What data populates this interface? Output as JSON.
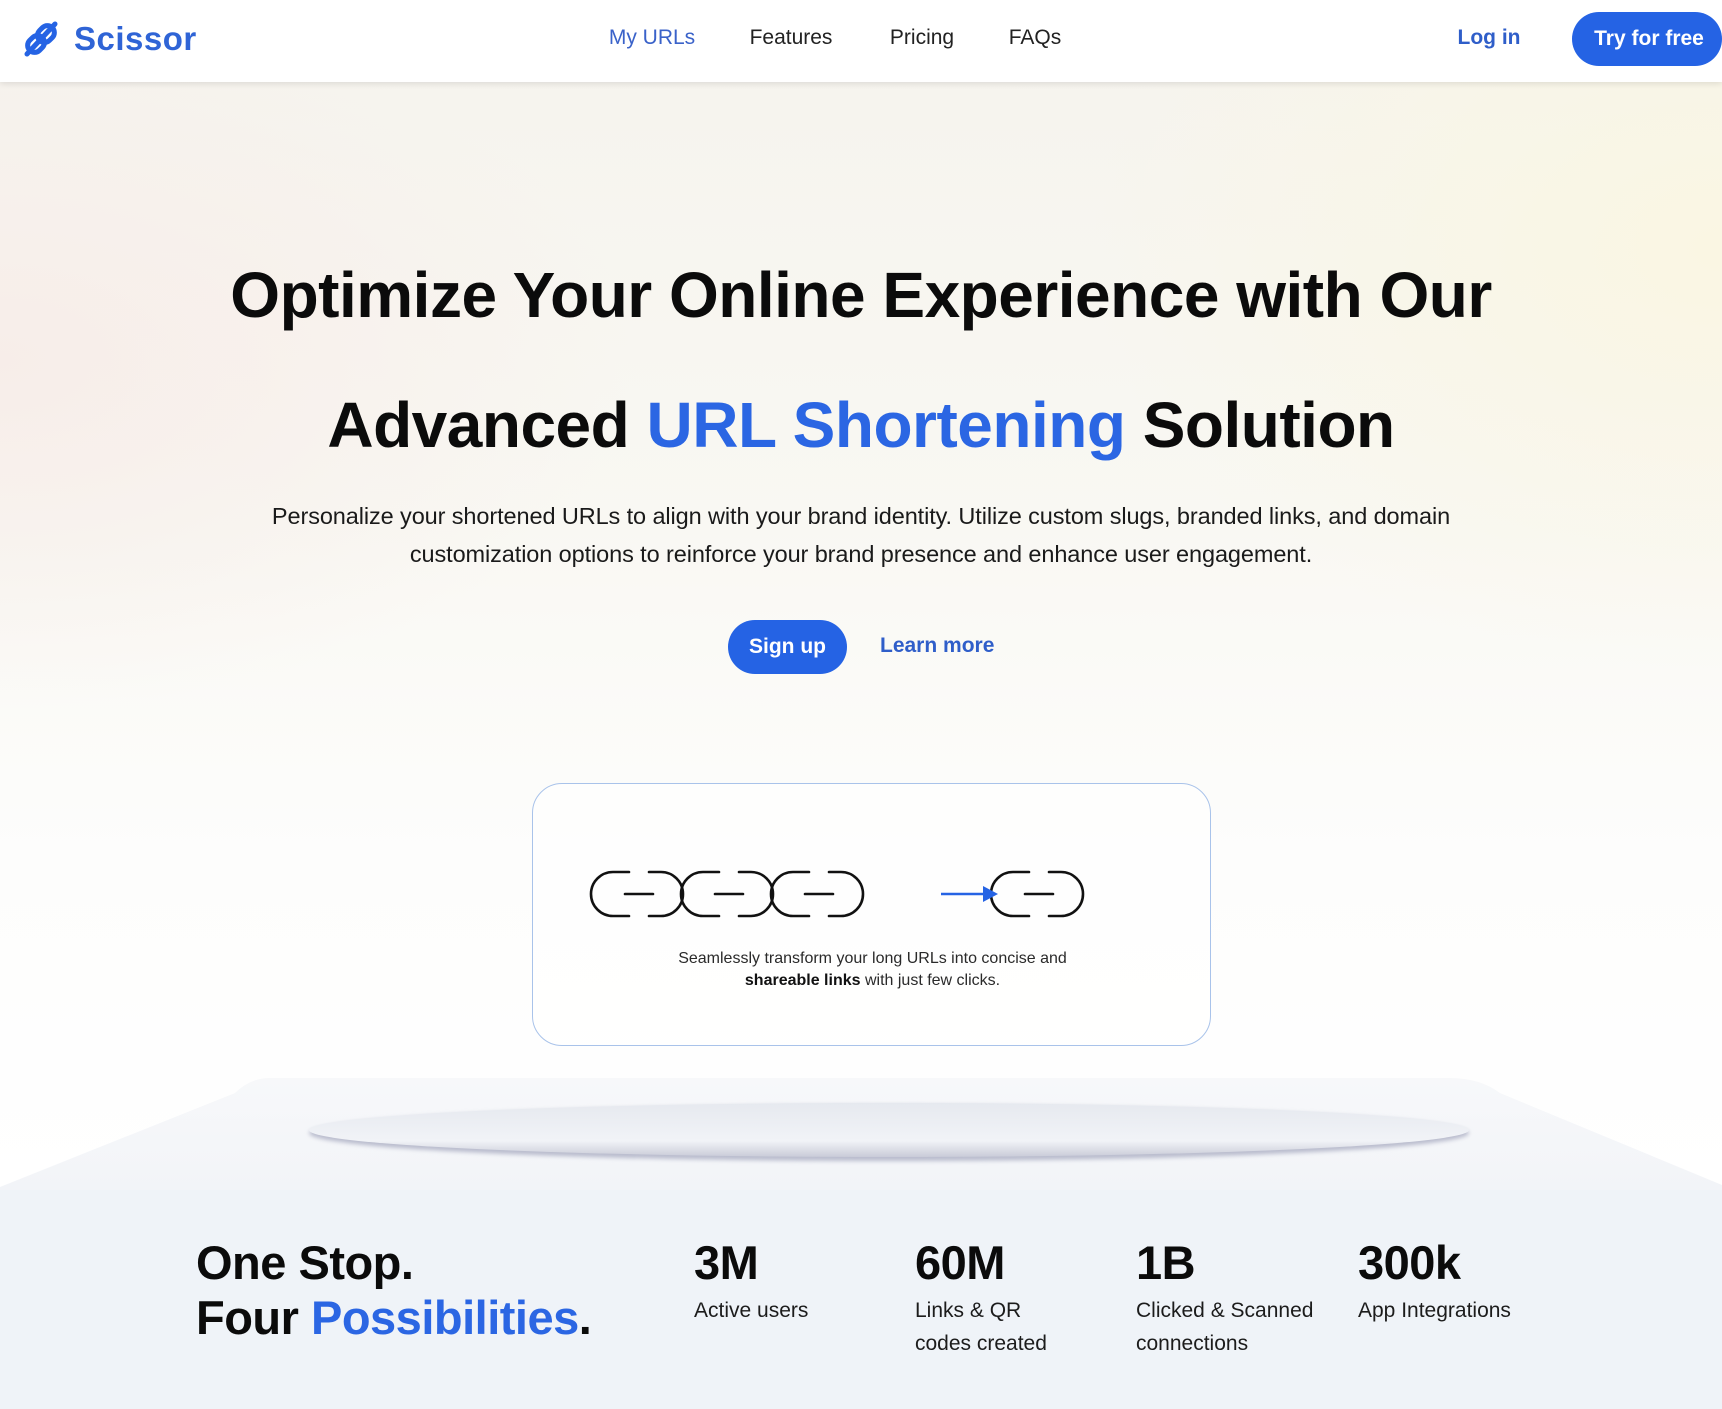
{
  "header": {
    "brand": "Scissor",
    "brand_icon": "chain-link-icon",
    "nav": [
      {
        "label": "My URLs",
        "active": true
      },
      {
        "label": "Features",
        "active": false
      },
      {
        "label": "Pricing",
        "active": false
      },
      {
        "label": "FAQs",
        "active": false
      }
    ],
    "login_label": "Log in",
    "cta_label": "Try for free"
  },
  "hero": {
    "headline_line1": "Optimize Your Online Experience with Our",
    "headline_line2_pre": "Advanced ",
    "headline_line2_accent": "URL Shortening",
    "headline_line2_post": " Solution",
    "paragraph_line1": "Personalize your shortened URLs to align with your brand identity. Utilize custom slugs, branded links, and domain",
    "paragraph_line2": "customization options to reinforce your brand presence and enhance user engagement.",
    "primary_button": "Sign up",
    "secondary_link": "Learn more"
  },
  "illustration_card": {
    "long_chain_links": 3,
    "short_chain_links": 1,
    "arrow_icon": "arrow-right-icon",
    "caption_line1": "Seamlessly transform your long URLs into concise and",
    "caption_line2_bold": "shareable links",
    "caption_line2_rest": " with just few clicks."
  },
  "stats_section": {
    "tagline_line1": "One Stop.",
    "tagline_line2_pre": "Four ",
    "tagline_line2_accent": "Possibilities",
    "tagline_line2_post": ".",
    "stats": [
      {
        "value": "3M",
        "label_line1": "Active users",
        "label_line2": ""
      },
      {
        "value": "60M",
        "label_line1": "Links & QR",
        "label_line2": "codes created"
      },
      {
        "value": "1B",
        "label_line1": "Clicked & Scanned",
        "label_line2": "connections"
      },
      {
        "value": "300k",
        "label_line1": "App Integrations",
        "label_line2": ""
      }
    ]
  },
  "colors": {
    "brand_blue": "#2563e4",
    "accent_text_blue": "#2b66e3",
    "nav_active": "#3a62c9",
    "card_border": "#a9c3ea",
    "stats_bg": "#eff3f8"
  }
}
